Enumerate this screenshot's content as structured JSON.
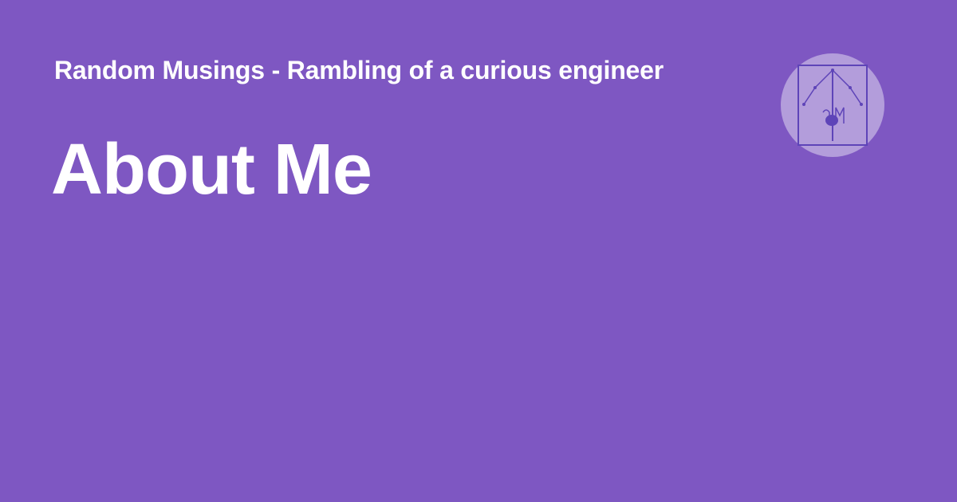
{
  "site_title": "Random Musings - Rambling of a curious engineer",
  "page_title": "About Me",
  "logo": {
    "text": "aM",
    "icon": "house-music-logo"
  },
  "colors": {
    "background": "#7e57c2",
    "logo_circle": "#b39ddb",
    "logo_stroke": "#5e44b8"
  }
}
